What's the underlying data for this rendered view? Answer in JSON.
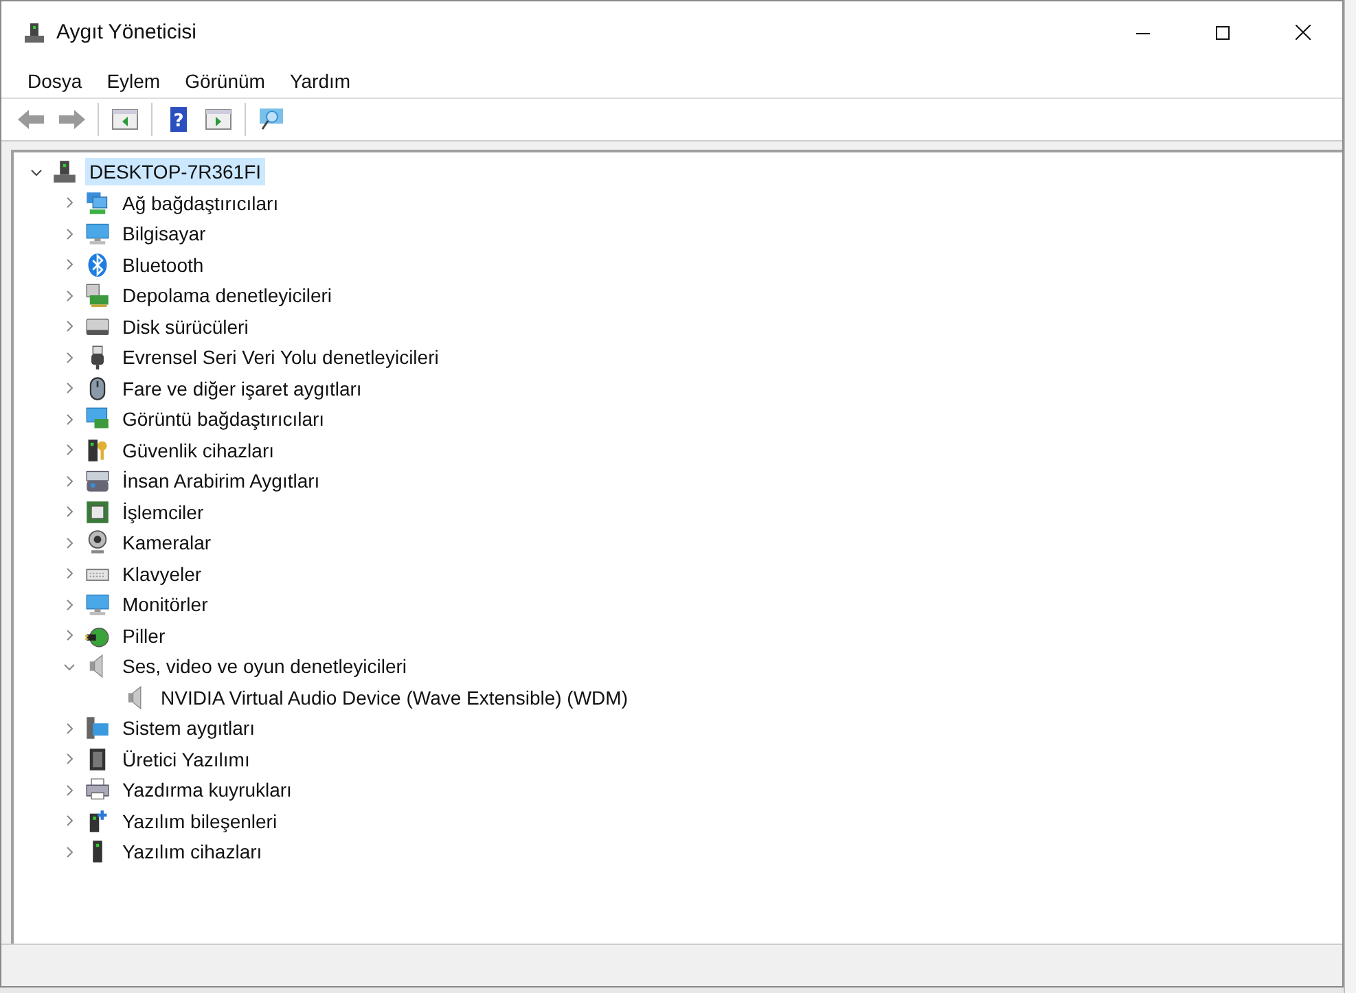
{
  "window": {
    "title": "Aygıt Yöneticisi"
  },
  "menu": [
    {
      "label": "Dosya"
    },
    {
      "label": "Eylem"
    },
    {
      "label": "Görünüm"
    },
    {
      "label": "Yardım"
    }
  ],
  "toolbar": [
    {
      "kind": "back",
      "disabled": true
    },
    {
      "kind": "forward",
      "disabled": true
    },
    {
      "kind": "separator"
    },
    {
      "kind": "tree"
    },
    {
      "kind": "separator"
    },
    {
      "kind": "help",
      "glyph": "?"
    },
    {
      "kind": "pane"
    },
    {
      "kind": "separator"
    },
    {
      "kind": "scan"
    }
  ],
  "tree": {
    "label": "DESKTOP-7R361FI",
    "expanded": true,
    "selected": true,
    "children": [
      {
        "label": "Ağ bağdaştırıcıları",
        "expanded": false,
        "selected": false
      },
      {
        "label": "Bilgisayar",
        "expanded": false,
        "selected": false
      },
      {
        "label": "Bluetooth",
        "expanded": false,
        "selected": false
      },
      {
        "label": "Depolama denetleyicileri",
        "expanded": false,
        "selected": false
      },
      {
        "label": "Disk sürücüleri",
        "expanded": false,
        "selected": false
      },
      {
        "label": "Evrensel Seri Veri Yolu denetleyicileri",
        "expanded": false,
        "selected": false
      },
      {
        "label": "Fare ve diğer işaret aygıtları",
        "expanded": false,
        "selected": false
      },
      {
        "label": "Görüntü bağdaştırıcıları",
        "expanded": false,
        "selected": false
      },
      {
        "label": "Güvenlik cihazları",
        "expanded": false,
        "selected": false
      },
      {
        "label": "İnsan Arabirim Aygıtları",
        "expanded": false,
        "selected": false
      },
      {
        "label": "İşlemciler",
        "expanded": false,
        "selected": false
      },
      {
        "label": "Kameralar",
        "expanded": false,
        "selected": false
      },
      {
        "label": "Klavyeler",
        "expanded": false,
        "selected": false
      },
      {
        "label": "Monitörler",
        "expanded": false,
        "selected": false
      },
      {
        "label": "Piller",
        "expanded": false,
        "selected": false
      },
      {
        "label": "Ses, video ve oyun denetleyicileri",
        "expanded": true,
        "selected": false,
        "children": [
          {
            "label": "NVIDIA Virtual Audio Device (Wave Extensible) (WDM)",
            "selected": false
          }
        ]
      },
      {
        "label": "Sistem aygıtları",
        "expanded": false,
        "selected": false
      },
      {
        "label": "Üretici Yazılımı",
        "expanded": false,
        "selected": false
      },
      {
        "label": "Yazdırma kuyrukları",
        "expanded": false,
        "selected": false
      },
      {
        "label": "Yazılım bileşenleri",
        "expanded": false,
        "selected": false
      },
      {
        "label": "Yazılım cihazları",
        "expanded": false,
        "selected": false
      }
    ]
  }
}
